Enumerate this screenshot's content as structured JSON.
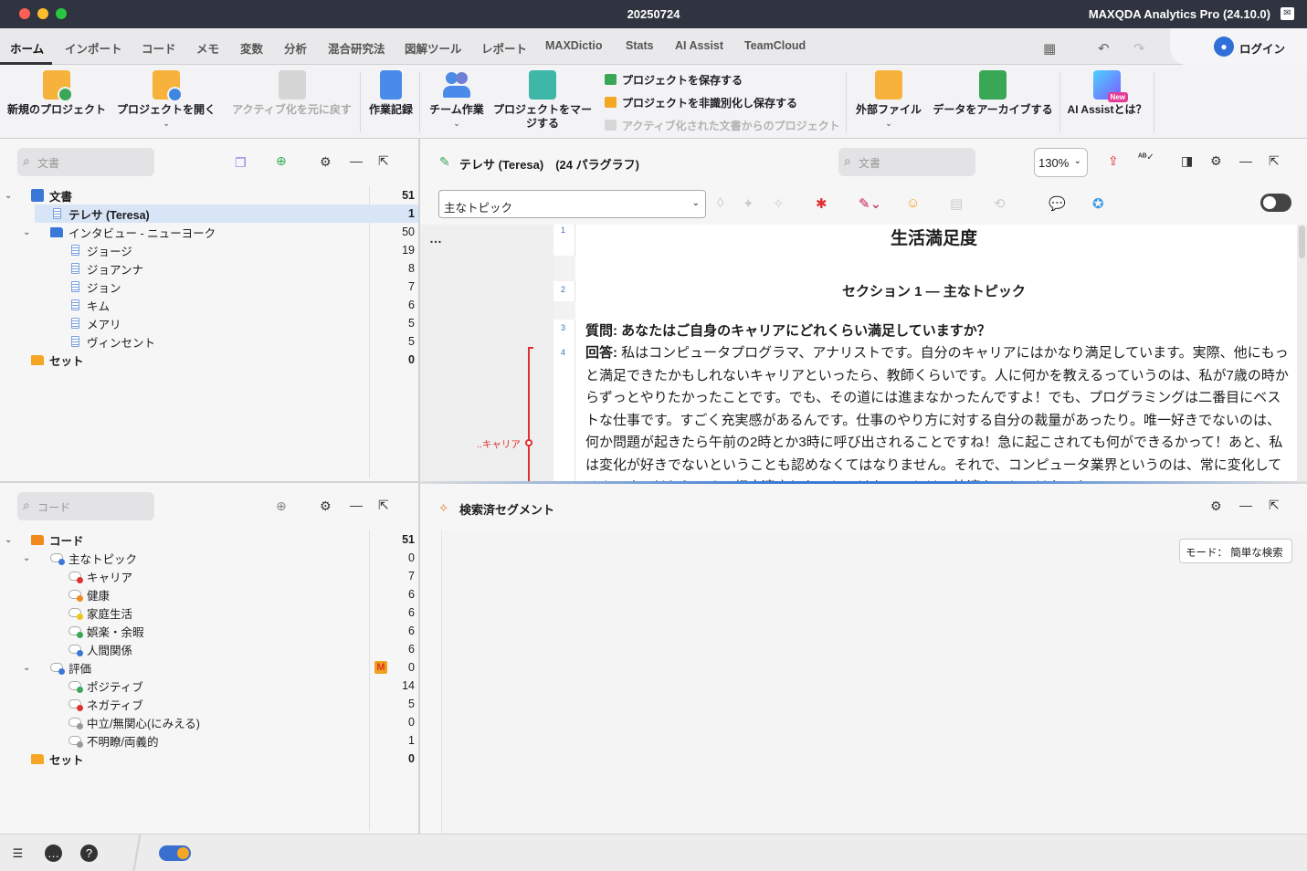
{
  "window": {
    "title": "20250724",
    "app_name": "MAXQDA Analytics Pro (24.10.0)"
  },
  "menu": {
    "tabs": [
      "ホーム",
      "インポート",
      "コード",
      "メモ",
      "変数",
      "分析",
      "混合研究法",
      "図解ツール",
      "レポート",
      "MAXDictio",
      "Stats",
      "AI Assist",
      "TeamCloud"
    ],
    "login_label": "ログイン"
  },
  "ribbon": {
    "new_project": "新規のプロジェクト",
    "open_project": "プロジェクトを開く",
    "undo_activation": "アクティブ化を元に戻す",
    "work_log": "作業記録",
    "teamwork": "チーム作業",
    "merge_projects": "プロジェクトをマージする",
    "save_project": "プロジェクトを保存する",
    "save_anonymized": "プロジェクトを非識別化し保存する",
    "project_from_activated": "アクティブ化された文書からのプロジェクト",
    "external_files": "外部ファイル",
    "archive_data": "データをアーカイブする",
    "ai_assist": "AI Assistとは？",
    "new_badge": "New"
  },
  "documents_panel": {
    "search_placeholder": "文書",
    "root": {
      "label": "文書",
      "count": "51"
    },
    "items": [
      {
        "label": "テレサ (Teresa)",
        "count": "1"
      },
      {
        "label": "インタビュー - ニューヨーク",
        "count": "50"
      },
      {
        "label": "ジョージ",
        "count": "19"
      },
      {
        "label": "ジョアンナ",
        "count": "8"
      },
      {
        "label": "ジョン",
        "count": "7"
      },
      {
        "label": "キム",
        "count": "6"
      },
      {
        "label": "メアリ",
        "count": "5"
      },
      {
        "label": "ヴィンセント",
        "count": "5"
      }
    ],
    "sets": {
      "label": "セット",
      "count": "0"
    }
  },
  "codes_panel": {
    "search_placeholder": "コード",
    "root": {
      "label": "コード",
      "count": "51"
    },
    "items": [
      {
        "label": "主なトピック",
        "count": "0",
        "color": "#3a78d8"
      },
      {
        "label": "キャリア",
        "count": "7",
        "color": "#e03030"
      },
      {
        "label": "健康",
        "count": "6",
        "color": "#f08a1c"
      },
      {
        "label": "家庭生活",
        "count": "6",
        "color": "#f2c417"
      },
      {
        "label": "娯楽・余暇",
        "count": "6",
        "color": "#3aa757"
      },
      {
        "label": "人間関係",
        "count": "6",
        "color": "#3a78d8"
      },
      {
        "label": "評価",
        "count": "0",
        "color": "#3a78d8"
      },
      {
        "label": "ポジティブ",
        "count": "14",
        "color": "#3aa757"
      },
      {
        "label": "ネガティブ",
        "count": "5",
        "color": "#e03030"
      },
      {
        "label": "中立/無関心(にみえる)",
        "count": "0",
        "color": "#999999"
      },
      {
        "label": "不明瞭/両義的",
        "count": "1",
        "color": "#999999"
      }
    ],
    "sets": {
      "label": "セット",
      "count": "0"
    },
    "memo_badge": "M"
  },
  "document_browser": {
    "title": "テレサ (Teresa)　(24 パラグラフ)",
    "search_placeholder": "文書",
    "zoom": "130%",
    "code_dropdown": "主なトピック",
    "more": "…",
    "paragraph_numbers": [
      "1",
      "2",
      "3",
      "4"
    ],
    "heading": "生活満足度",
    "section": "セクション 1 — 主なトピック",
    "question": "質問: あなたはご自身のキャリアにどれくらい満足していますか？",
    "answer_label": "回答: ",
    "answer": "私はコンピュータプログラマ、アナリストです。自分のキャリアにはかなり満足しています。実際、他にもっと満足できたかもしれないキャリアといったら、教師くらいです。人に何かを教えるっていうのは、私が7歳の時からずっとやりたかったことです。でも、その道には進まなかったんですよ！でも、プログラミングは二番目にベストな仕事です。すごく充実感があるんです。仕事のやり方に対する自分の裁量があったり。唯一好きでないのは、何か問題が起きたら午前の2時とか3時に呼び出されることですね！急に起こされても何ができるかって！あと、私は変化が好きでないということも認めなくてはなりません。それで、コンピュータ業界というのは、常に変化してるんです。だから、その都度適応しないといけないことは、快適なことではないね",
    "coding_label": "..キャリア"
  },
  "retrieved_segments": {
    "title": "検索済セグメント",
    "mode_label": "モード： 簡単な検索"
  },
  "colors": {
    "accent": "#3a78d8",
    "career_code": "#e03030"
  }
}
